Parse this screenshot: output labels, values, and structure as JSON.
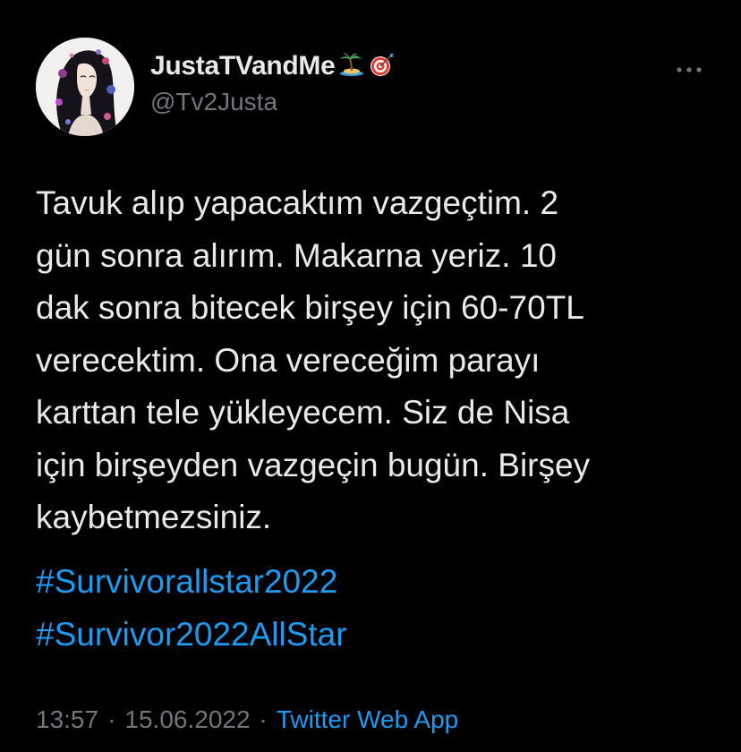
{
  "author": {
    "display_name": "JustaTVandMe",
    "handle": "@Tv2Justa",
    "name_emojis": [
      "island-emoji",
      "direct-hit-emoji"
    ]
  },
  "tweet": {
    "text_lines": [
      "Tavuk alıp yapacaktım vazgeçtim. 2",
      "gün sonra alırım. Makarna yeriz. 10",
      "dak sonra bitecek birşey için 60-70TL",
      "verecektim. Ona vereceğim parayı",
      "karttan tele yükleyecem. Siz de Nisa",
      "için birşeyden vazgeçin bugün. Birşey",
      "kaybetmezsiniz."
    ],
    "hashtags": [
      "#Survivorallstar2022",
      "#Survivor2022AllStar"
    ]
  },
  "meta": {
    "time": "13:57",
    "separator": "·",
    "date": "15.06.2022",
    "source": "Twitter Web App"
  },
  "icons": {
    "more": "more-dots-icon"
  },
  "colors": {
    "background": "#000000",
    "text": "#e7e9ea",
    "secondary": "#71767b",
    "link": "#1d9bf0"
  }
}
